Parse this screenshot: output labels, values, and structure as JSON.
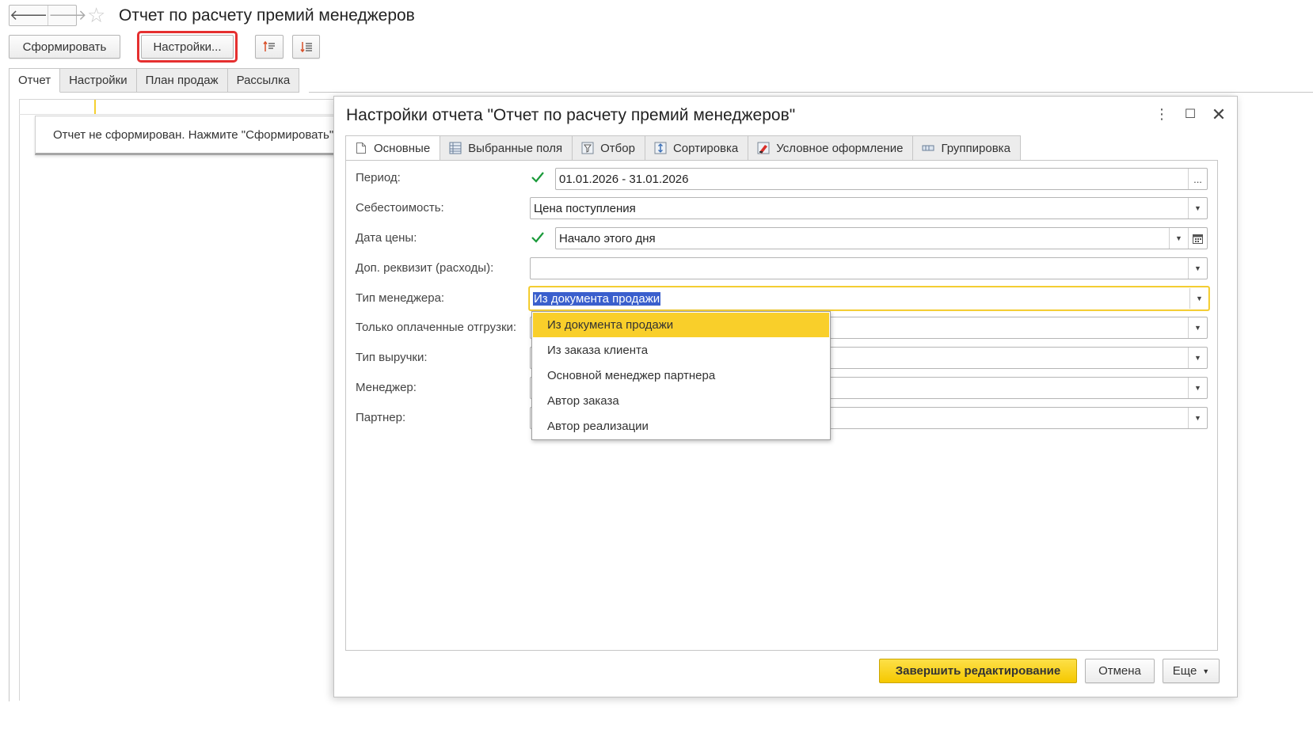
{
  "window": {
    "title": "Отчет по расчету премий менеджеров",
    "nav_back_glyph": "🡐",
    "nav_forward_glyph": "🡒",
    "favorite_glyph": "☆"
  },
  "toolbar": {
    "generate_label": "Сформировать",
    "settings_label": "Настройки...",
    "sort_asc_icon": "sort-ascending-icon",
    "sort_desc_icon": "sort-descending-icon",
    "highlight_color": "#e53030"
  },
  "main_tabs": [
    {
      "label": "Отчет",
      "active": true
    },
    {
      "label": "Настройки",
      "active": false
    },
    {
      "label": "План продаж",
      "active": false
    },
    {
      "label": "Рассылка",
      "active": false
    }
  ],
  "report": {
    "not_generated_message": "Отчет не сформирован. Нажмите \"Сформировать\" для получения отчета."
  },
  "dialog": {
    "title": "Настройки отчета \"Отчет по расчету премий менеджеров\"",
    "menu_glyph": "⋮",
    "maximize_glyph": "☐",
    "close_glyph": "✕",
    "tabs": [
      {
        "label": "Основные",
        "icon": "document-icon",
        "active": true
      },
      {
        "label": "Выбранные поля",
        "icon": "fields-icon",
        "active": false
      },
      {
        "label": "Отбор",
        "icon": "filter-icon",
        "active": false
      },
      {
        "label": "Сортировка",
        "icon": "sort-icon",
        "active": false
      },
      {
        "label": "Условное оформление",
        "icon": "conditional-format-icon",
        "active": false
      },
      {
        "label": "Группировка",
        "icon": "grouping-icon",
        "active": false
      }
    ],
    "form": {
      "period": {
        "label": "Период:",
        "checked": true,
        "value": "01.01.2026 - 31.01.2026",
        "select_glyph": "..."
      },
      "cost": {
        "label": "Себестоимость:",
        "value": "Цена поступления"
      },
      "price_date": {
        "label": "Дата цены:",
        "checked": true,
        "value": "Начало этого дня"
      },
      "extra_attr": {
        "label": "Доп. реквизит (расходы):",
        "value": ""
      },
      "manager_type": {
        "label": "Тип менеджера:",
        "value": "Из документа продажи"
      },
      "paid_only": {
        "label": "Только оплаченные отгрузки:",
        "value": ""
      },
      "revenue_type": {
        "label": "Тип выручки:",
        "value": ""
      },
      "manager": {
        "label": "Менеджер:",
        "value": ""
      },
      "partner": {
        "label": "Партнер:",
        "value": ""
      }
    },
    "dropdown_options": [
      "Из документа продажи",
      "Из заказа клиента",
      "Основной менеджер партнера",
      "Автор заказа",
      "Автор реализации"
    ],
    "dropdown_selected": "Из документа продажи",
    "buttons": {
      "finish": "Завершить редактирование",
      "cancel": "Отмена",
      "more": "Еще"
    },
    "accent_color": "#f5c800",
    "check_color": "#1a9a3a"
  }
}
